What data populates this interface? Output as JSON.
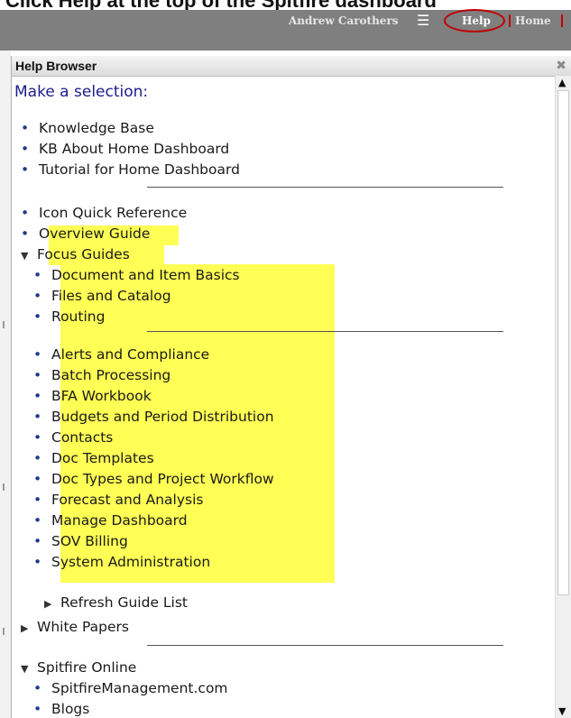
{
  "caption": "Click Help at the top of the Spitfire dashboard",
  "topbar": {
    "user_name": "Andrew Carothers",
    "menu_icon": "hamburger-menu-icon",
    "help_label": "Help",
    "home_label": "Home",
    "ring_color": "#c00000"
  },
  "panel": {
    "title": "Help Browser",
    "close_glyph": "✖",
    "prompt": "Make a selection:"
  },
  "items": [
    {
      "label": "Knowledge Base",
      "marker": "•"
    },
    {
      "label": "KB About Home Dashboard",
      "marker": "•"
    },
    {
      "label": "Tutorial for Home Dashboard",
      "marker": "•"
    },
    {
      "label": "Icon Quick Reference",
      "marker": "•"
    },
    {
      "label": "Overview Guide",
      "marker": "•"
    },
    {
      "label": "Focus Guides",
      "marker": "▼"
    },
    {
      "label": "Document and Item Basics",
      "marker": "•"
    },
    {
      "label": "Files and Catalog",
      "marker": "•"
    },
    {
      "label": "Routing",
      "marker": "•"
    },
    {
      "label": "Alerts and Compliance",
      "marker": "•"
    },
    {
      "label": "Batch Processing",
      "marker": "•"
    },
    {
      "label": "BFA Workbook",
      "marker": "•"
    },
    {
      "label": "Budgets and Period Distribution",
      "marker": "•"
    },
    {
      "label": "Contacts",
      "marker": "•"
    },
    {
      "label": "Doc Templates",
      "marker": "•"
    },
    {
      "label": "Doc Types and Project Workflow",
      "marker": "•"
    },
    {
      "label": "Forecast and Analysis",
      "marker": "•"
    },
    {
      "label": "Manage Dashboard",
      "marker": "•"
    },
    {
      "label": "SOV Billing",
      "marker": "•"
    },
    {
      "label": "System Administration",
      "marker": "•"
    },
    {
      "label": "Refresh Guide List",
      "marker": "▶"
    },
    {
      "label": "White Papers",
      "marker": "▶"
    },
    {
      "label": "Spitfire Online",
      "marker": "▼"
    },
    {
      "label": "SpitfireManagement.com",
      "marker": "•"
    },
    {
      "label": "Blogs",
      "marker": "•"
    }
  ],
  "highlight_color": "#ffff55"
}
